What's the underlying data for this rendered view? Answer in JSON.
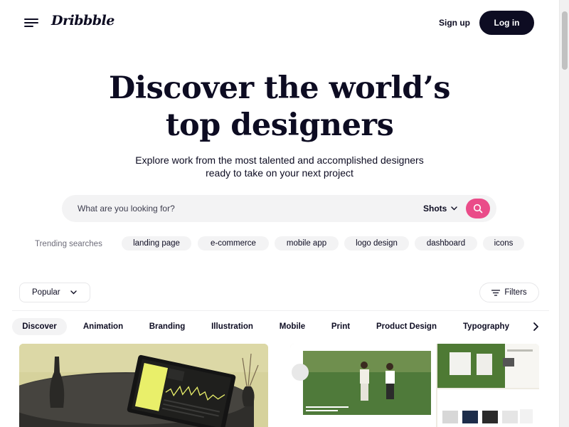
{
  "header": {
    "logo": "Dribbble",
    "signup_label": "Sign up",
    "login_label": "Log in"
  },
  "hero": {
    "title_line1": "Discover the world’s",
    "title_line2": "top designers",
    "subtitle_line1": "Explore work from the most talented and accomplished designers",
    "subtitle_line2": "ready to take on your next project"
  },
  "search": {
    "placeholder": "What are you looking for?",
    "value": "",
    "type_label": "Shots"
  },
  "trending": {
    "label": "Trending searches",
    "tags": [
      "landing page",
      "e-commerce",
      "mobile app",
      "logo design",
      "dashboard",
      "icons"
    ]
  },
  "filters": {
    "sort_label": "Popular",
    "filters_label": "Filters"
  },
  "categories": {
    "items": [
      "Discover",
      "Animation",
      "Branding",
      "Illustration",
      "Mobile",
      "Print",
      "Product Design",
      "Typography"
    ],
    "active": "Discover"
  },
  "colors": {
    "brand_dark": "#0d0c22",
    "accent_pink": "#ea4c89",
    "chip_bg": "#f3f3f4"
  },
  "icons": {
    "menu": "hamburger-icon",
    "search": "search-icon",
    "chevron": "chevron-down-icon",
    "filters": "filter-lines-icon",
    "next": "chevron-right-icon"
  }
}
